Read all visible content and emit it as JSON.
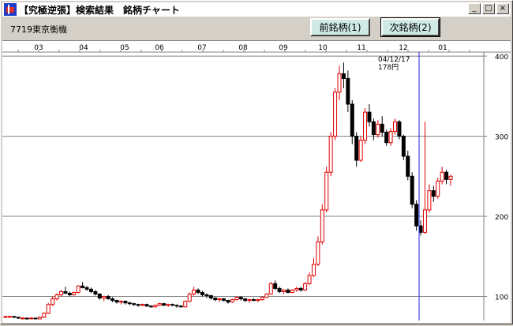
{
  "window": {
    "title": "【究極逆張】検索結果　銘柄チャート",
    "minimize_glyph": "_",
    "restore_glyph": "□",
    "close_glyph": "×"
  },
  "toolbar": {
    "stock": "7719東京衡機",
    "prev_label": "前銘柄(1)",
    "next_label": "次銘柄(2)"
  },
  "chart_data": {
    "type": "candlestick",
    "x_tick_labels": [
      "03",
      "04",
      "05",
      "06",
      "07",
      "08",
      "09",
      "10",
      "11",
      "12",
      "01"
    ],
    "y_ticks": [
      100,
      200,
      300,
      400
    ],
    "ylim": [
      70,
      405
    ],
    "cursor": {
      "date": "04/12/17",
      "price": "178円"
    },
    "colors": {
      "up": "#e00000",
      "down": "#000000",
      "grid": "#808080",
      "cursor": "#2020e0"
    },
    "series": [
      {
        "name": "",
        "values": [
          [
            74,
            75,
            73,
            75
          ],
          [
            75,
            76,
            74,
            75
          ],
          [
            75,
            75,
            73,
            74
          ],
          [
            74,
            74,
            72,
            73
          ],
          [
            73,
            74,
            72,
            73
          ],
          [
            73,
            73,
            71,
            72
          ],
          [
            72,
            74,
            72,
            73
          ],
          [
            73,
            73,
            72,
            72
          ],
          [
            72,
            75,
            72,
            74
          ],
          [
            74,
            80,
            73,
            79
          ],
          [
            79,
            92,
            78,
            90
          ],
          [
            90,
            100,
            88,
            97
          ],
          [
            97,
            104,
            95,
            102
          ],
          [
            102,
            108,
            100,
            106
          ],
          [
            106,
            112,
            103,
            104
          ],
          [
            104,
            106,
            100,
            102
          ],
          [
            102,
            106,
            101,
            105
          ],
          [
            105,
            114,
            104,
            113
          ],
          [
            113,
            118,
            110,
            111
          ],
          [
            111,
            113,
            107,
            109
          ],
          [
            109,
            111,
            104,
            106
          ],
          [
            106,
            108,
            101,
            103
          ],
          [
            103,
            104,
            96,
            98
          ],
          [
            98,
            101,
            94,
            100
          ],
          [
            100,
            102,
            96,
            97
          ],
          [
            97,
            99,
            93,
            95
          ],
          [
            95,
            96,
            91,
            93
          ],
          [
            93,
            95,
            90,
            94
          ],
          [
            94,
            95,
            90,
            92
          ],
          [
            92,
            93,
            89,
            91
          ],
          [
            91,
            92,
            88,
            90
          ],
          [
            90,
            91,
            87,
            89
          ],
          [
            89,
            91,
            88,
            90
          ],
          [
            90,
            91,
            87,
            88
          ],
          [
            88,
            89,
            86,
            87
          ],
          [
            87,
            90,
            86,
            89
          ],
          [
            89,
            92,
            88,
            91
          ],
          [
            91,
            92,
            88,
            89
          ],
          [
            89,
            91,
            87,
            90
          ],
          [
            90,
            91,
            88,
            89
          ],
          [
            89,
            90,
            86,
            88
          ],
          [
            88,
            89,
            86,
            87
          ],
          [
            87,
            95,
            86,
            94
          ],
          [
            94,
            105,
            93,
            103
          ],
          [
            103,
            112,
            101,
            108
          ],
          [
            108,
            110,
            103,
            105
          ],
          [
            105,
            107,
            100,
            102
          ],
          [
            102,
            104,
            98,
            101
          ],
          [
            101,
            102,
            96,
            98
          ],
          [
            98,
            99,
            94,
            96
          ],
          [
            96,
            98,
            93,
            97
          ],
          [
            97,
            98,
            94,
            95
          ],
          [
            95,
            96,
            91,
            93
          ],
          [
            93,
            97,
            92,
            96
          ],
          [
            96,
            100,
            95,
            99
          ],
          [
            99,
            100,
            95,
            97
          ],
          [
            97,
            98,
            93,
            95
          ],
          [
            95,
            97,
            92,
            96
          ],
          [
            96,
            98,
            94,
            95
          ],
          [
            95,
            97,
            93,
            96
          ],
          [
            96,
            100,
            95,
            99
          ],
          [
            99,
            104,
            98,
            103
          ],
          [
            103,
            118,
            102,
            116
          ],
          [
            116,
            120,
            108,
            110
          ],
          [
            110,
            112,
            104,
            106
          ],
          [
            106,
            109,
            103,
            108
          ],
          [
            108,
            110,
            104,
            105
          ],
          [
            105,
            109,
            104,
            108
          ],
          [
            108,
            112,
            106,
            110
          ],
          [
            110,
            112,
            106,
            108
          ],
          [
            108,
            118,
            107,
            116
          ],
          [
            116,
            130,
            114,
            126
          ],
          [
            126,
            148,
            124,
            140
          ],
          [
            140,
            175,
            138,
            168
          ],
          [
            168,
            215,
            165,
            208
          ],
          [
            208,
            262,
            205,
            255
          ],
          [
            255,
            305,
            250,
            300
          ],
          [
            300,
            360,
            295,
            355
          ],
          [
            355,
            388,
            345,
            378
          ],
          [
            378,
            392,
            360,
            372
          ],
          [
            372,
            382,
            330,
            340
          ],
          [
            340,
            345,
            290,
            300
          ],
          [
            300,
            305,
            262,
            270
          ],
          [
            270,
            300,
            268,
            295
          ],
          [
            295,
            335,
            290,
            330
          ],
          [
            330,
            340,
            312,
            318
          ],
          [
            318,
            322,
            295,
            302
          ],
          [
            302,
            320,
            298,
            315
          ],
          [
            315,
            325,
            300,
            305
          ],
          [
            305,
            308,
            288,
            292
          ],
          [
            292,
            310,
            288,
            306
          ],
          [
            306,
            322,
            302,
            318
          ],
          [
            318,
            320,
            296,
            300
          ],
          [
            300,
            302,
            270,
            275
          ],
          [
            275,
            282,
            245,
            250
          ],
          [
            250,
            255,
            210,
            215
          ],
          [
            215,
            220,
            182,
            188
          ],
          [
            188,
            195,
            176,
            180
          ],
          [
            180,
            318,
            178,
            208
          ],
          [
            208,
            240,
            205,
            232
          ],
          [
            232,
            238,
            218,
            225
          ],
          [
            225,
            248,
            222,
            244
          ],
          [
            244,
            262,
            240,
            255
          ],
          [
            255,
            258,
            240,
            246
          ],
          [
            246,
            252,
            238,
            250
          ]
        ]
      }
    ]
  }
}
